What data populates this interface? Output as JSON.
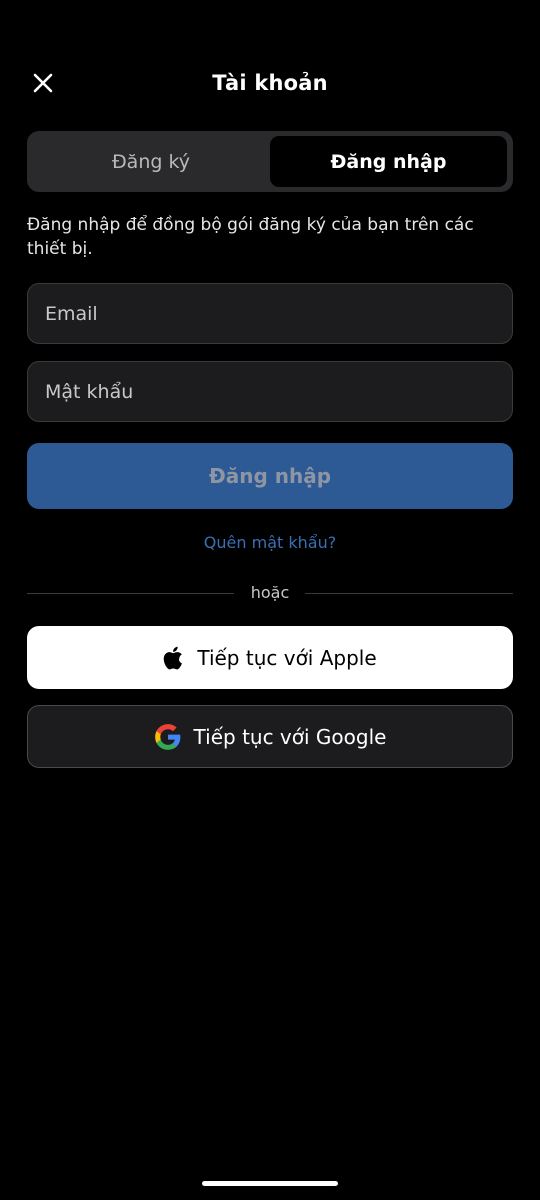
{
  "header": {
    "title": "Tài khoản",
    "close_icon": "close-icon"
  },
  "tabs": [
    {
      "label": "Đăng ký",
      "selected": false
    },
    {
      "label": "Đăng nhập",
      "selected": true
    }
  ],
  "description": "Đăng nhập để đồng bộ gói đăng ký của bạn trên các thiết bị.",
  "form": {
    "email_placeholder": "Email",
    "email_value": "",
    "password_placeholder": "Mật khẩu",
    "password_value": "",
    "submit_label": "Đăng nhập",
    "forgot_label": "Quên mật khẩu?"
  },
  "divider": {
    "label": "hoặc"
  },
  "social": {
    "apple_label": "Tiếp tục với Apple",
    "apple_icon": "apple-icon",
    "google_label": "Tiếp tục với Google",
    "google_icon": "google-icon"
  },
  "colors": {
    "background": "#000000",
    "primary_button": "#2d5a94",
    "link": "#3a6fb5",
    "field_background": "#1c1c1e"
  }
}
